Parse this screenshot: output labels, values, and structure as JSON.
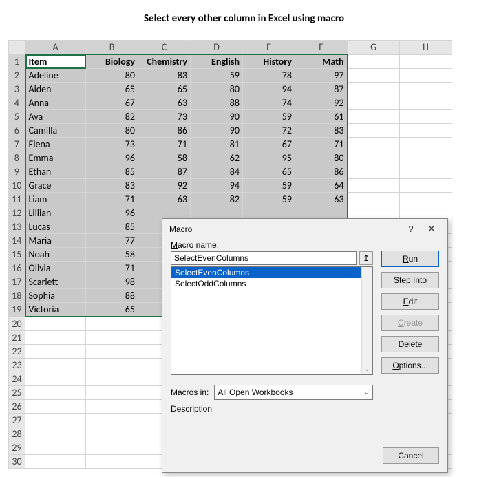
{
  "title": "Select every other column in Excel using macro",
  "columns": [
    "A",
    "B",
    "C",
    "D",
    "E",
    "F",
    "G",
    "H"
  ],
  "selected_columns": [
    "A",
    "B",
    "C",
    "D",
    "E",
    "F"
  ],
  "headers": [
    "Item",
    "Biology",
    "Chemistry",
    "English",
    "History",
    "Math"
  ],
  "rows": [
    {
      "n": 1
    },
    {
      "n": 2,
      "item": "Adeline",
      "v": [
        80,
        83,
        59,
        78,
        97
      ]
    },
    {
      "n": 3,
      "item": "Aiden",
      "v": [
        65,
        65,
        80,
        94,
        87
      ]
    },
    {
      "n": 4,
      "item": "Anna",
      "v": [
        67,
        63,
        88,
        74,
        92
      ]
    },
    {
      "n": 5,
      "item": "Ava",
      "v": [
        82,
        73,
        90,
        59,
        61
      ]
    },
    {
      "n": 6,
      "item": "Camilla",
      "v": [
        80,
        86,
        90,
        72,
        83
      ]
    },
    {
      "n": 7,
      "item": "Elena",
      "v": [
        73,
        71,
        81,
        67,
        71
      ]
    },
    {
      "n": 8,
      "item": "Emma",
      "v": [
        96,
        58,
        62,
        95,
        80
      ]
    },
    {
      "n": 9,
      "item": "Ethan",
      "v": [
        85,
        87,
        84,
        65,
        86
      ]
    },
    {
      "n": 10,
      "item": "Grace",
      "v": [
        83,
        92,
        94,
        59,
        64
      ]
    },
    {
      "n": 11,
      "item": "Liam",
      "v": [
        71,
        63,
        82,
        59,
        63
      ]
    },
    {
      "n": 12,
      "item": "Lillian",
      "v": [
        96,
        null,
        null,
        null,
        null
      ]
    },
    {
      "n": 13,
      "item": "Lucas",
      "v": [
        85,
        null,
        null,
        null,
        null
      ]
    },
    {
      "n": 14,
      "item": "Maria",
      "v": [
        77,
        null,
        null,
        null,
        null
      ]
    },
    {
      "n": 15,
      "item": "Noah",
      "v": [
        58,
        null,
        null,
        null,
        null
      ]
    },
    {
      "n": 16,
      "item": "Olivia",
      "v": [
        71,
        null,
        null,
        null,
        null
      ]
    },
    {
      "n": 17,
      "item": "Scarlett",
      "v": [
        98,
        null,
        null,
        null,
        null
      ]
    },
    {
      "n": 18,
      "item": "Sophia",
      "v": [
        88,
        null,
        null,
        null,
        null
      ]
    },
    {
      "n": 19,
      "item": "Victoria",
      "v": [
        65,
        null,
        null,
        null,
        null
      ]
    }
  ],
  "extra_rows": [
    20,
    21,
    22,
    23,
    24,
    25,
    26,
    27,
    28,
    29,
    30
  ],
  "dialog": {
    "title": "Macro",
    "help_glyph": "?",
    "close_glyph": "✕",
    "name_label": "Macro name:",
    "name_underline": "M",
    "name_value": "SelectEvenColumns",
    "up_glyph": "↥",
    "list": [
      {
        "label": "SelectEvenColumns",
        "selected": true
      },
      {
        "label": "SelectOddColumns",
        "selected": false
      }
    ],
    "macros_in_label": "Macros in:",
    "macros_in_value": "All Open Workbooks",
    "description_label": "Description",
    "buttons": {
      "run": {
        "label": "Run",
        "ul": "R"
      },
      "step": {
        "label": "Step Into",
        "ul": "S"
      },
      "edit": {
        "label": "Edit",
        "ul": "E"
      },
      "create": {
        "label": "Create",
        "ul": "C",
        "disabled": true
      },
      "delete": {
        "label": "Delete",
        "ul": "D"
      },
      "options": {
        "label": "Options...",
        "ul": "O"
      },
      "cancel": {
        "label": "Cancel"
      }
    }
  }
}
